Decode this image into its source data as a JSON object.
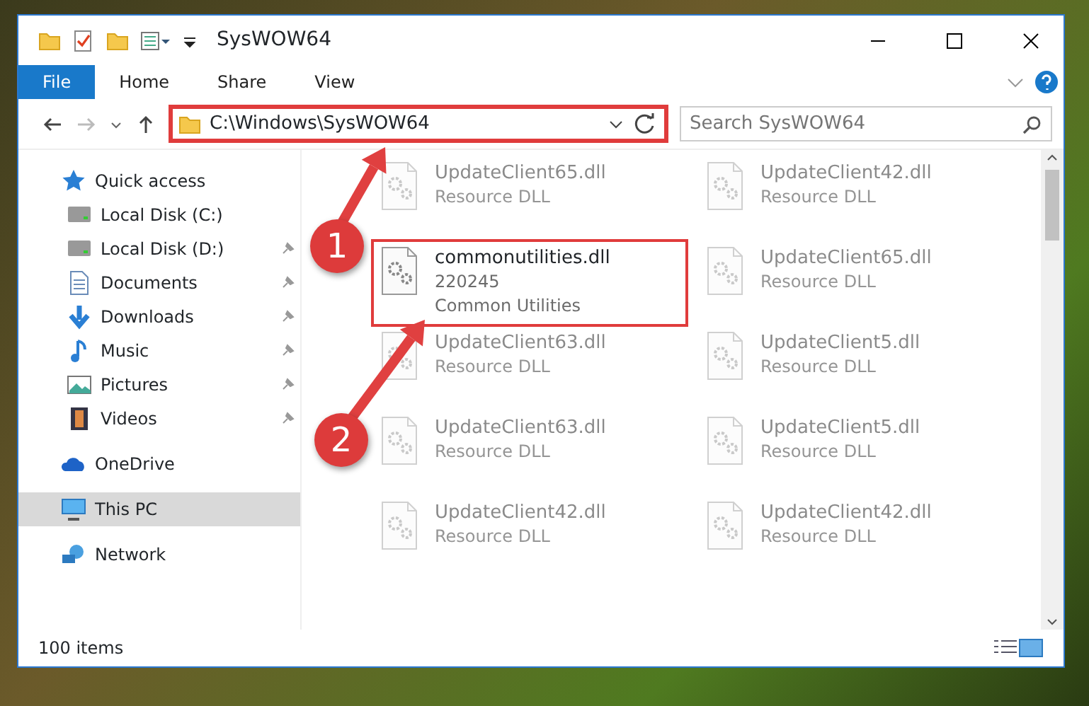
{
  "window": {
    "title": "SysWOW64"
  },
  "ribbon_tabs": [
    {
      "label": "File",
      "selected": true
    },
    {
      "label": "Home",
      "selected": false
    },
    {
      "label": "Share",
      "selected": false
    },
    {
      "label": "View",
      "selected": false
    }
  ],
  "address_bar": {
    "path": "C:\\Windows\\SysWOW64",
    "highlighted": true
  },
  "search": {
    "placeholder": "Search SysWOW64"
  },
  "sidebar": {
    "items": [
      {
        "label": "Quick access",
        "selected": false,
        "children": [
          {
            "label": "Local Disk (C:)",
            "pinned": false,
            "selected": false
          },
          {
            "label": "Local Disk (D:)",
            "pinned": true,
            "selected": false
          },
          {
            "label": "Documents",
            "pinned": true,
            "selected": false
          },
          {
            "label": "Downloads",
            "pinned": true,
            "selected": false
          },
          {
            "label": "Music",
            "pinned": true,
            "selected": false
          },
          {
            "label": "Pictures",
            "pinned": true,
            "selected": false
          },
          {
            "label": "Videos",
            "pinned": true,
            "selected": false
          }
        ]
      },
      {
        "label": "OneDrive",
        "selected": false
      },
      {
        "label": "This PC",
        "selected": true
      },
      {
        "label": "Network",
        "selected": false
      }
    ]
  },
  "files": [
    {
      "name": "UpdateClient65.dll",
      "type": "Resource DLL",
      "blurred": true,
      "highlighted": false
    },
    {
      "name": "UpdateClient42.dll",
      "type": "Resource DLL",
      "blurred": true,
      "highlighted": false
    },
    {
      "name": "commonutilities.dll",
      "version": "220245",
      "type": "Common Utilities",
      "blurred": false,
      "highlighted": true
    },
    {
      "name": "UpdateClient65.dll",
      "type": "Resource DLL",
      "blurred": true,
      "highlighted": false
    },
    {
      "name": "UpdateClient63.dll",
      "type": "Resource DLL",
      "blurred": true,
      "highlighted": false
    },
    {
      "name": "UpdateClient5.dll",
      "type": "Resource DLL",
      "blurred": true,
      "highlighted": false
    },
    {
      "name": "UpdateClient63.dll",
      "type": "Resource DLL",
      "blurred": true,
      "highlighted": false
    },
    {
      "name": "UpdateClient5.dll",
      "type": "Resource DLL",
      "blurred": true,
      "highlighted": false
    },
    {
      "name": "UpdateClient42.dll",
      "type": "Resource DLL",
      "blurred": true,
      "highlighted": false
    },
    {
      "name": "UpdateClient42.dll",
      "type": "Resource DLL",
      "blurred": true,
      "highlighted": false
    }
  ],
  "status_bar": {
    "item_count": "100 items"
  },
  "callouts": [
    {
      "number": "1"
    },
    {
      "number": "2"
    }
  ]
}
